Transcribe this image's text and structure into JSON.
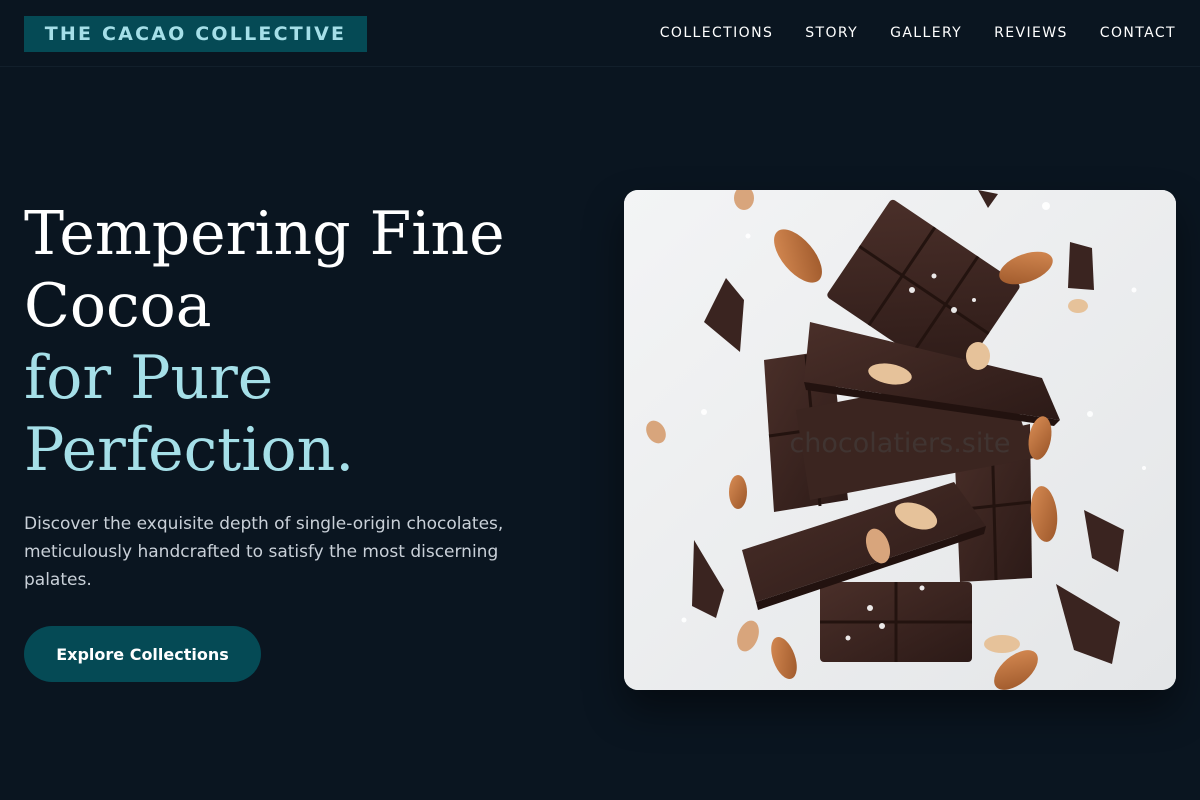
{
  "brand": {
    "name": "THE CACAO COLLECTIVE"
  },
  "nav": {
    "items": [
      "COLLECTIONS",
      "STORY",
      "GALLERY",
      "REVIEWS",
      "CONTACT"
    ]
  },
  "hero": {
    "title_line1": "Tempering Fine",
    "title_line2": "Cocoa",
    "title_line3": "for Pure",
    "title_line4": "Perfection.",
    "description": "Discover the exquisite depth of single-origin chocolates, meticulously handcrafted to satisfy the most discerning palates.",
    "cta_label": "Explore Collections",
    "image_watermark": "chocolatiers.site"
  },
  "colors": {
    "background": "#0a1520",
    "accent": "#a5dfe8",
    "brand_teal": "#054a55",
    "chocolate": "#3a2420"
  }
}
